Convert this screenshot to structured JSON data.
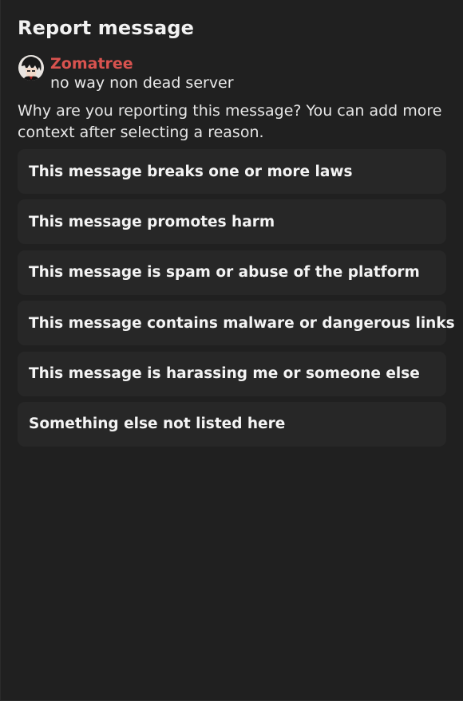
{
  "dialog": {
    "title": "Report message"
  },
  "message": {
    "author": "Zomatree",
    "author_color": "#d9534f",
    "content": "no way non dead server",
    "avatar_icon": "user-avatar"
  },
  "prompt": "Why are you reporting this message? You can add more context after selecting a reason.",
  "reasons": [
    {
      "label": "This message breaks one or more laws"
    },
    {
      "label": "This message promotes harm"
    },
    {
      "label": "This message is spam or abuse of the platform"
    },
    {
      "label": "This message contains malware or dangerous links"
    },
    {
      "label": "This message is harassing me or someone else"
    },
    {
      "label": "Something else not listed here"
    }
  ],
  "colors": {
    "background": "#202020",
    "option_background": "#272727",
    "text": "#f4f4f4"
  }
}
